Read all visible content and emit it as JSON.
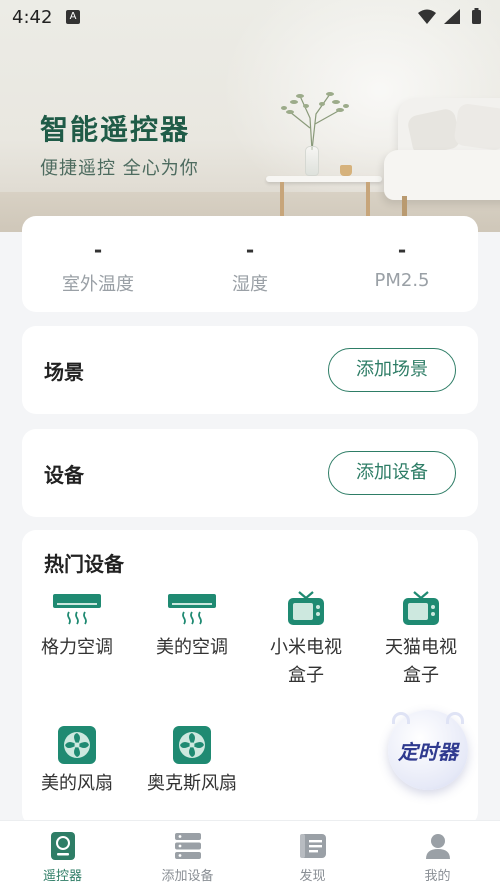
{
  "status_bar": {
    "time": "4:42",
    "notification_glyph": "A"
  },
  "hero": {
    "title": "智能遥控器",
    "subtitle": "便捷遥控 全心为你"
  },
  "weather": {
    "items": [
      {
        "value": "-",
        "label": "室外温度"
      },
      {
        "value": "-",
        "label": "湿度"
      },
      {
        "value": "-",
        "label": "PM2.5"
      }
    ]
  },
  "scenes": {
    "title": "场景",
    "button": "添加场景"
  },
  "devices": {
    "title": "设备",
    "button": "添加设备"
  },
  "hot_devices": {
    "title": "热门设备",
    "items": [
      {
        "icon": "air-conditioner-icon",
        "label": "格力空调"
      },
      {
        "icon": "air-conditioner-icon",
        "label": "美的空调"
      },
      {
        "icon": "tv-box-icon",
        "label": "小米电视\n盒子"
      },
      {
        "icon": "tv-box-icon",
        "label": "天猫电视\n盒子"
      },
      {
        "icon": "fan-icon",
        "label": "美的风扇"
      },
      {
        "icon": "fan-icon",
        "label": "奥克斯风扇"
      }
    ]
  },
  "timer": {
    "label": "定时器"
  },
  "bottom_nav": {
    "items": [
      {
        "icon": "remote-icon",
        "label": "遥控器",
        "active": true
      },
      {
        "icon": "server-icon",
        "label": "添加设备",
        "active": false
      },
      {
        "icon": "discover-icon",
        "label": "发现",
        "active": false
      },
      {
        "icon": "user-icon",
        "label": "我的",
        "active": false
      }
    ]
  },
  "colors": {
    "accent": "#2e7d66",
    "icon_teal": "#1f8a72",
    "timer": "#2f3a8f"
  }
}
